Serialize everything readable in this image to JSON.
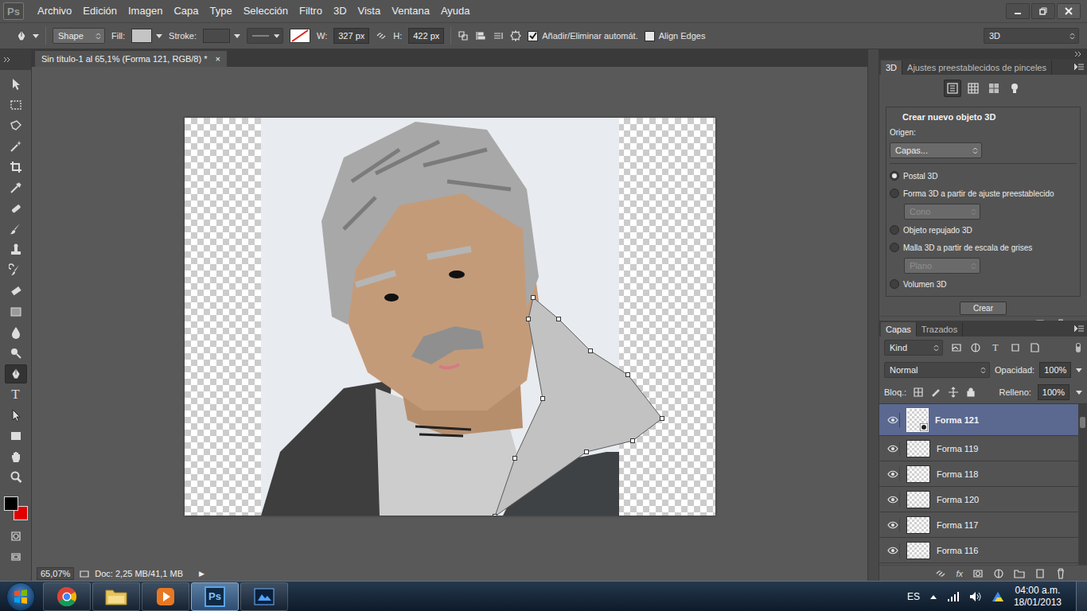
{
  "app": {
    "logo": "Ps"
  },
  "menu": [
    "Archivo",
    "Edición",
    "Imagen",
    "Capa",
    "Type",
    "Selección",
    "Filtro",
    "3D",
    "Vista",
    "Ventana",
    "Ayuda"
  ],
  "options_bar": {
    "mode": "Shape",
    "fill_label": "Fill:",
    "stroke_label": "Stroke:",
    "w_label": "W:",
    "w_value": "327 px",
    "h_label": "H:",
    "h_value": "422 px",
    "checkboxes": [
      {
        "label": "Añadir/Eliminar automát.",
        "checked": true
      },
      {
        "label": "Align Edges",
        "checked": false
      }
    ],
    "workspace": "3D"
  },
  "document": {
    "tab": "Sin título-1 al 65,1% (Forma 121, RGB/8) *",
    "close": "×"
  },
  "tools": [
    {
      "kind": "move",
      "selected": false
    },
    {
      "kind": "marquee",
      "selected": false
    },
    {
      "kind": "lasso",
      "selected": false
    },
    {
      "kind": "wand",
      "selected": false
    },
    {
      "kind": "crop",
      "selected": false
    },
    {
      "kind": "eyedropper",
      "selected": false
    },
    {
      "kind": "heal",
      "selected": false
    },
    {
      "kind": "brush",
      "selected": false
    },
    {
      "kind": "stamp",
      "selected": false
    },
    {
      "kind": "history",
      "selected": false
    },
    {
      "kind": "eraser",
      "selected": false
    },
    {
      "kind": "gradient",
      "selected": false
    },
    {
      "kind": "blur",
      "selected": false
    },
    {
      "kind": "dodge",
      "selected": false
    },
    {
      "kind": "pen",
      "selected": true
    },
    {
      "kind": "type",
      "glyph": "T",
      "selected": false
    },
    {
      "kind": "path-select",
      "selected": false
    },
    {
      "kind": "shape",
      "selected": false
    },
    {
      "kind": "hand",
      "selected": false
    },
    {
      "kind": "zoom",
      "selected": false
    }
  ],
  "status_bar": {
    "zoom": "65,07%",
    "doc": "Doc: 2,25 MB/41,1 MB",
    "arrow": "▶"
  },
  "panel_3d": {
    "tabs": [
      {
        "label": "3D",
        "selected": true
      },
      {
        "label": "Ajustes preestablecidos de pinceles",
        "selected": false
      }
    ],
    "modes": [
      {
        "kind": "scene",
        "selected": true
      },
      {
        "kind": "mesh",
        "selected": false
      },
      {
        "kind": "material",
        "selected": false
      },
      {
        "kind": "light",
        "selected": false
      }
    ],
    "group_title": "Crear nuevo objeto 3D",
    "source_label": "Origen:",
    "source": "Capas...",
    "options": [
      {
        "label": "Postal 3D",
        "selected": true
      },
      {
        "label": "Forma 3D a partir de ajuste preestablecido",
        "selected": false,
        "sub": "Cono",
        "sub_disabled": true
      },
      {
        "label": "Objeto repujado 3D",
        "selected": false
      },
      {
        "label": "Malla 3D a partir de escala de grises",
        "selected": false,
        "sub": "Plano",
        "sub_disabled": true
      },
      {
        "label": "Volumen 3D",
        "selected": false
      }
    ],
    "button": "Crear"
  },
  "layers_panel": {
    "tabs": [
      {
        "label": "Capas",
        "selected": true
      },
      {
        "label": "Trazados",
        "selected": false
      }
    ],
    "filter": "Kind",
    "filter_glyph": "T",
    "blend": "Normal",
    "opacity_label": "Opacidad:",
    "opacity": "100%",
    "lock_label": "Bloq.:",
    "fill_label": "Relleno:",
    "fill": "100%",
    "footer_glyph": "fx",
    "layers": [
      {
        "name": "Forma 121",
        "visible": true,
        "selected": true
      },
      {
        "name": "Forma 119",
        "visible": true,
        "selected": false
      },
      {
        "name": "Forma 118",
        "visible": true,
        "selected": false
      },
      {
        "name": "Forma 120",
        "visible": true,
        "selected": false
      },
      {
        "name": "Forma 117",
        "visible": true,
        "selected": false
      },
      {
        "name": "Forma 116",
        "visible": true,
        "selected": false
      }
    ]
  },
  "taskbar": {
    "apps": [
      {
        "kind": "chrome",
        "active": false
      },
      {
        "kind": "explorer",
        "active": false
      },
      {
        "kind": "media",
        "active": false
      },
      {
        "kind": "photoshop",
        "label": "Ps",
        "active": true
      },
      {
        "kind": "other",
        "active": false
      }
    ],
    "language": "ES",
    "time": "04:00 a.m.",
    "date": "18/01/2013"
  }
}
